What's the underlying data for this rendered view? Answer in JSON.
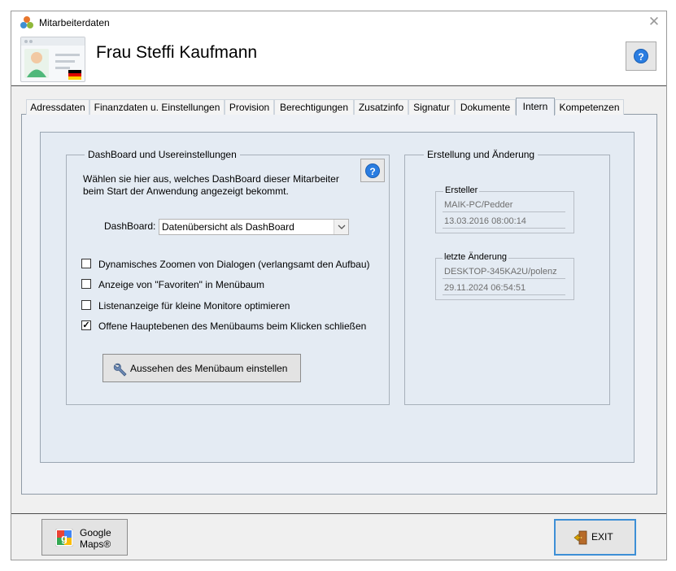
{
  "window": {
    "title": "Mitarbeiterdaten",
    "close_symbol": "✕"
  },
  "header": {
    "employee_name": "Frau Steffi Kaufmann",
    "help_symbol": "?"
  },
  "tabs": [
    {
      "label": "Adressdaten"
    },
    {
      "label": "Finanzdaten u. Einstellungen"
    },
    {
      "label": "Provision"
    },
    {
      "label": "Berechtigungen"
    },
    {
      "label": "Zusatzinfo"
    },
    {
      "label": "Signatur"
    },
    {
      "label": "Dokumente"
    },
    {
      "label": "Intern"
    },
    {
      "label": "Kompetenzen"
    }
  ],
  "active_tab": "Intern",
  "dashboard_group": {
    "title": "DashBoard und Usereinstellungen",
    "description_line1": "Wählen sie hier aus, welches DashBoard dieser Mitarbeiter",
    "description_line2": "beim Start der Anwendung angezeigt bekommt.",
    "dashboard_label": "DashBoard:",
    "dashboard_value": "Datenübersicht als DashBoard",
    "help_symbol": "?",
    "checkboxes": [
      {
        "label": "Dynamisches Zoomen von Dialogen (verlangsamt den Aufbau)",
        "checked": false
      },
      {
        "label": "Anzeige von \"Favoriten\" in Menübaum",
        "checked": false
      },
      {
        "label": "Listenanzeige für kleine Monitore optimieren",
        "checked": false
      },
      {
        "label": "Offene Hauptebenen des Menübaums beim Klicken schließen",
        "checked": true
      }
    ],
    "check_mark": "✓",
    "menu_button_label": "Aussehen des Menübaum einstellen"
  },
  "creation_group": {
    "title": "Erstellung und Änderung",
    "creator": {
      "label": "Ersteller",
      "user": "MAIK-PC/Pedder",
      "timestamp": "13.03.2016 08:00:14"
    },
    "modified": {
      "label": "letzte Änderung",
      "user": "DESKTOP-345KA2U/polenz",
      "timestamp": "29.11.2024 06:54:51"
    }
  },
  "footer": {
    "google_maps_line1": "Google",
    "google_maps_line2": "Maps®",
    "exit_label": "EXIT"
  },
  "colors": {
    "accent_blue": "#2a7de1",
    "panel_bg": "#e4ebf3",
    "google_red": "#ea4335",
    "google_green": "#34a853",
    "google_blue": "#4285f4",
    "google_yellow": "#fbbc05"
  },
  "icons": {
    "app": "app-logo-icon",
    "employee": "employee-card-icon",
    "help": "help-icon",
    "wrench": "wrench-icon",
    "maps": "google-maps-icon",
    "exit": "exit-door-icon"
  }
}
